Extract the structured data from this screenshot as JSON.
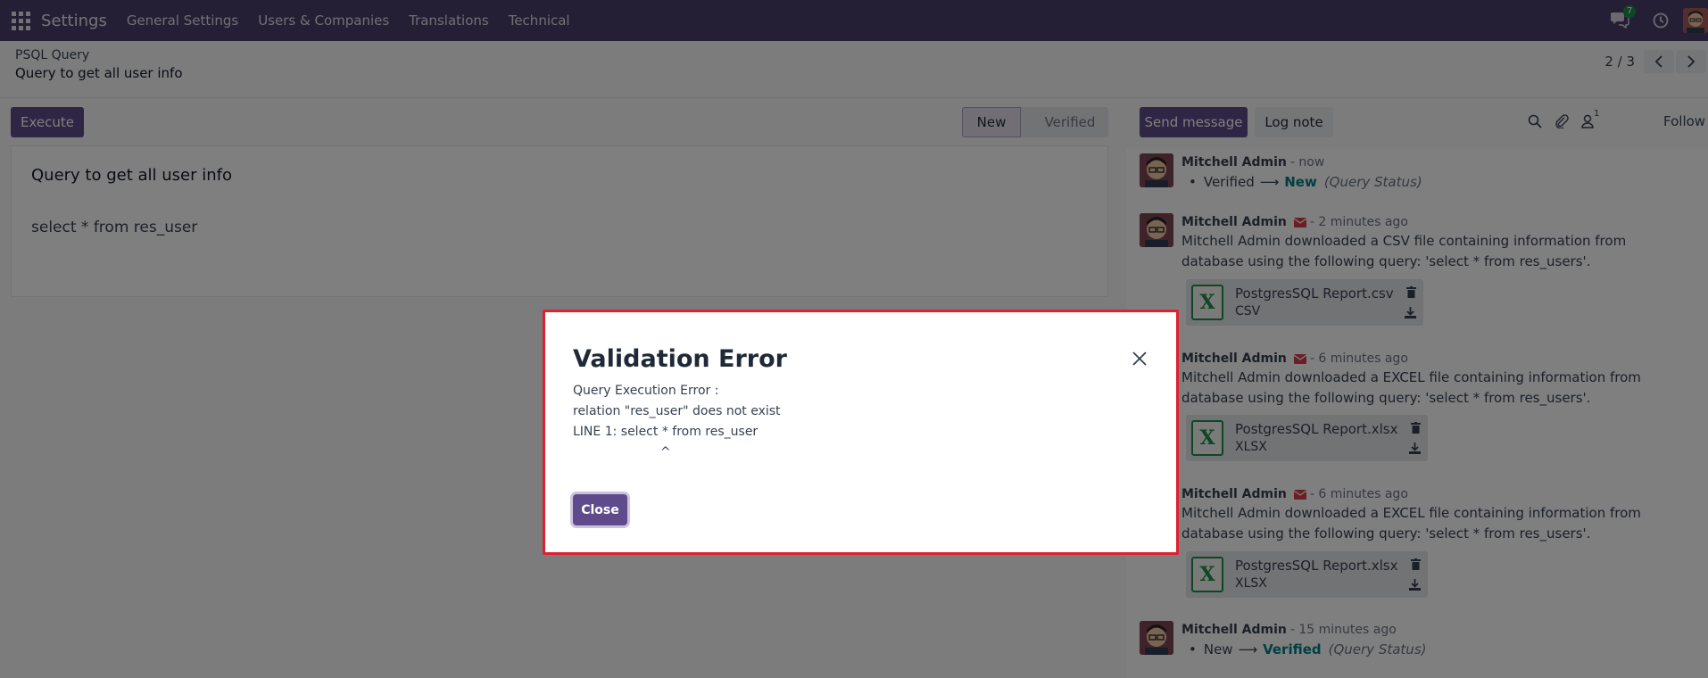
{
  "navbar": {
    "brand": "Settings",
    "menu": [
      "General Settings",
      "Users & Companies",
      "Translations",
      "Technical"
    ],
    "messages_badge": "7"
  },
  "control_panel": {
    "breadcrumb": "PSQL Query",
    "record_title": "Query to get all user info",
    "pager_value": "2 / 3"
  },
  "form": {
    "execute_label": "Execute",
    "status_steps": [
      "New",
      "Verified"
    ],
    "active_status": "New",
    "name": "Query to get all user info",
    "query": "select * from res_user"
  },
  "chatter": {
    "send_message_label": "Send message",
    "log_note_label": "Log note",
    "followers_count": "1",
    "follow_label": "Follow",
    "messages": [
      {
        "author": "Mitchell Admin",
        "time": "- now",
        "tracking": {
          "old": "Verified",
          "new": "New",
          "field": "(Query Status)"
        }
      },
      {
        "author": "Mitchell Admin",
        "time": "- 2 minutes ago",
        "text": "Mitchell Admin downloaded a CSV file containing information from database using the following query: 'select * from res_users'.",
        "attachment": {
          "name": "PostgresSQL Report.csv",
          "ext": "CSV"
        }
      },
      {
        "author": "Mitchell Admin",
        "time": "- 6 minutes ago",
        "text": "Mitchell Admin downloaded a EXCEL file containing information from database using the following query: 'select * from res_users'.",
        "attachment": {
          "name": "PostgresSQL Report.xlsx",
          "ext": "XLSX"
        }
      },
      {
        "author": "Mitchell Admin",
        "time": "- 6 minutes ago",
        "text": "Mitchell Admin downloaded a EXCEL file containing information from database using the following query: 'select * from res_users'.",
        "attachment": {
          "name": "PostgresSQL Report.xlsx",
          "ext": "XLSX"
        }
      },
      {
        "author": "Mitchell Admin",
        "time": "- 15 minutes ago",
        "tracking": {
          "old": "New",
          "new": "Verified",
          "field": "(Query Status)"
        }
      }
    ]
  },
  "dialog": {
    "title": "Validation Error",
    "body": "Query Execution Error :\nrelation \"res_user\" does not exist\nLINE 1: select * from res_user\n                      ^",
    "close_label": "Close"
  },
  "colors": {
    "navbar": "#4b3f6b",
    "primary": "#5f4b8b",
    "dialog_border": "#e0202f",
    "tracking_new": "#017e84",
    "excel_green": "#1f8c4a"
  }
}
